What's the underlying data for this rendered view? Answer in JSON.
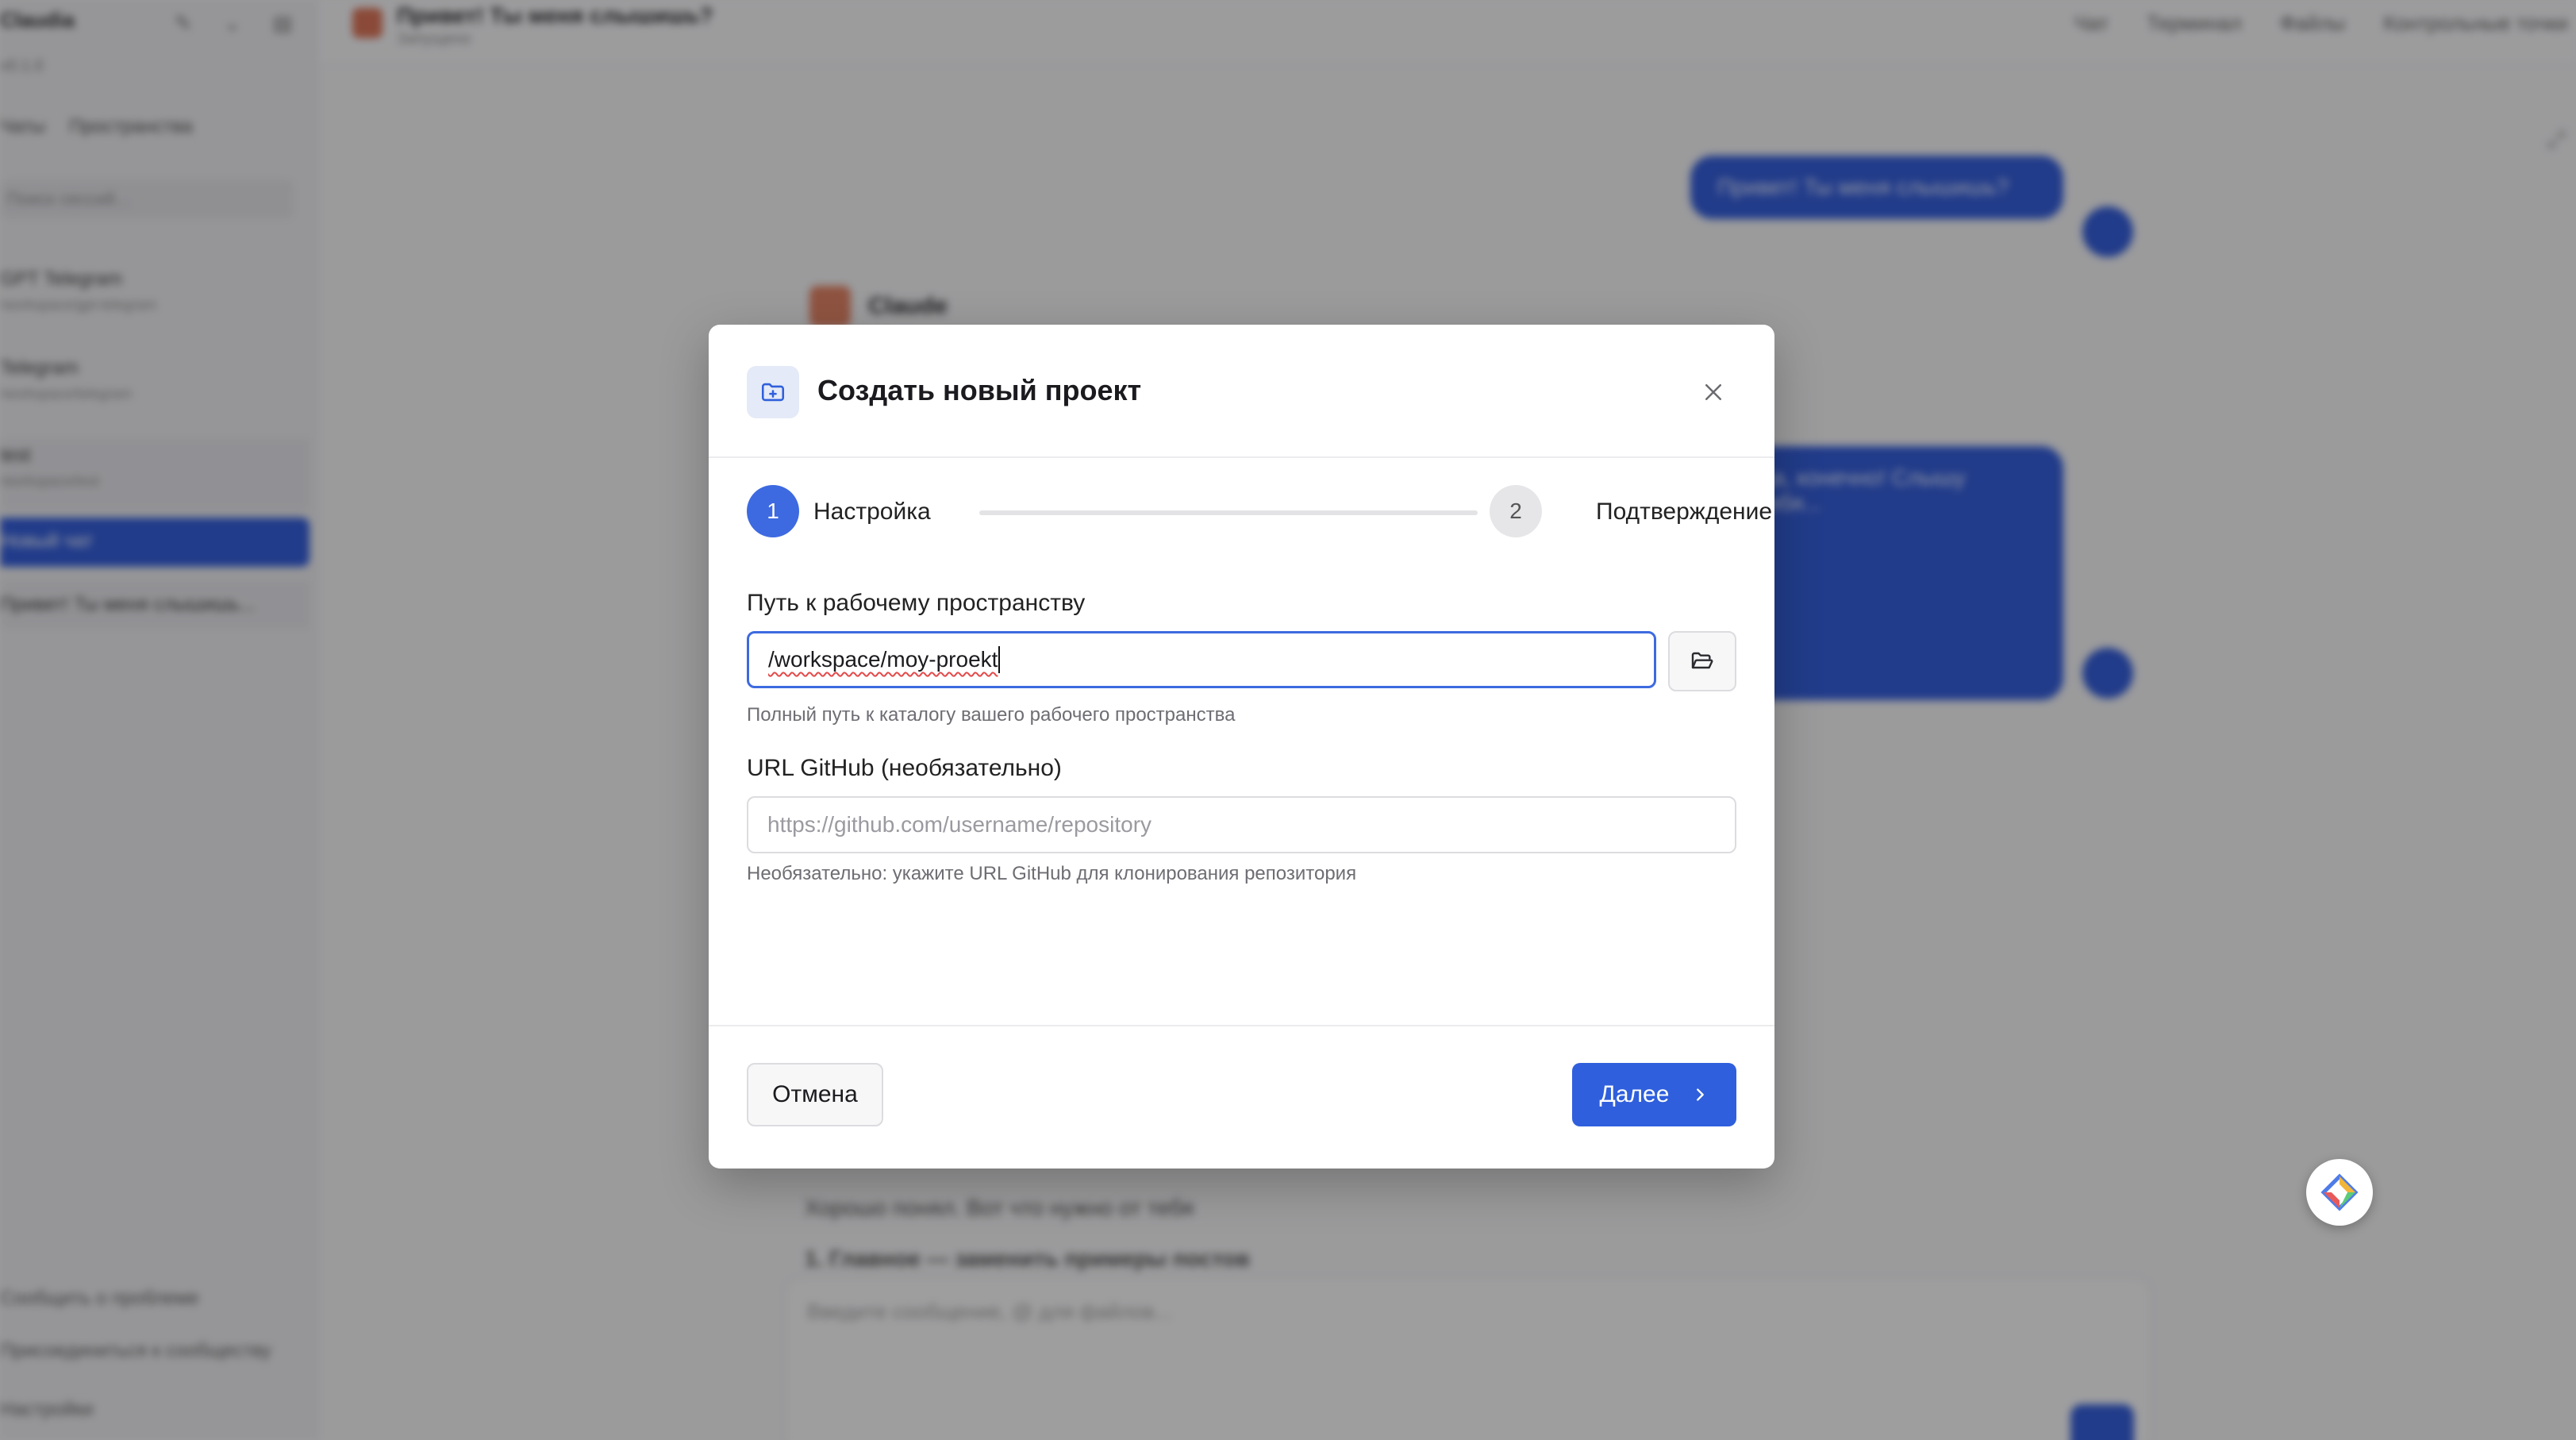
{
  "background": {
    "sidebar": {
      "app_name": "Claudia",
      "subtitle": "v0.1.0",
      "tabs": [
        "Чаты",
        "Пространства"
      ],
      "search_placeholder": "Поиск сессий...",
      "sessions": [
        {
          "title": "GPT Telegram",
          "meta": "/workspace/gpt-telegram"
        },
        {
          "title": "Telegram",
          "meta": "/workspace/telegram"
        },
        {
          "title": "test",
          "meta": "/workspace/test"
        }
      ],
      "active_item": "Новый чат",
      "recent_item": "Привет! Ты меня слышишь...",
      "bottom_links": [
        "Сообщить о проблеме",
        "Присоединиться к сообществу",
        "Настройки"
      ]
    },
    "topbar": {
      "title": "Привет! Ты меня слышишь?",
      "subtitle": "Запущено",
      "actions": [
        "Чат",
        "Терминал",
        "Файлы",
        "Контрольные точки"
      ]
    },
    "chat": {
      "user_message_1": "Привет! Ты меня слышишь?",
      "assistant_name": "Claude",
      "user_message_2": "Да, конечно! Слышу тебя...",
      "line_1": "Хорошо понял. Вот что нужно от тебя",
      "line_2": "1. Главное — заменить примеры постов",
      "composer_placeholder": "Введите сообщение, @ для файлов..."
    }
  },
  "modal": {
    "title": "Создать новый проект",
    "close_icon": "close-icon",
    "steps": [
      {
        "number": "1",
        "label": "Настройка",
        "state": "active"
      },
      {
        "number": "2",
        "label": "Подтверждение",
        "state": "inactive"
      }
    ],
    "workspace": {
      "label": "Путь к рабочему пространству",
      "value": "/workspace/moy-proekt",
      "hint": "Полный путь к каталогу вашего рабочего пространства",
      "browse_icon": "folder-open-icon"
    },
    "github": {
      "label": "URL GitHub (необязательно)",
      "placeholder": "https://github.com/username/repository",
      "hint": "Необязательно: укажите URL GitHub для клонирования репозитория"
    },
    "footer": {
      "cancel_label": "Отмена",
      "next_label": "Далее"
    }
  },
  "colors": {
    "accent": "#3d6ae0",
    "primary_button": "#2f5fdc",
    "overlay": "rgba(30,30,34,0.42)"
  }
}
